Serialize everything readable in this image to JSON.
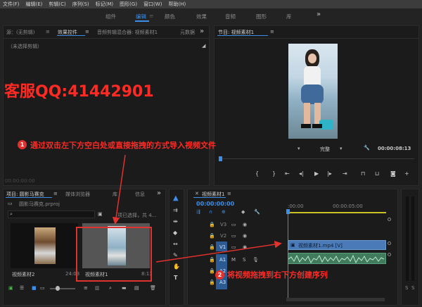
{
  "menu": [
    "文件(F)",
    "编辑(E)",
    "剪辑(C)",
    "序列(S)",
    "标记(M)",
    "图形(G)",
    "窗口(W)",
    "帮助(H)"
  ],
  "workspaces": {
    "assembly": "组件",
    "editing": "编辑",
    "color": "颜色",
    "effects": "效果",
    "audio": "音频",
    "graphics": "图形",
    "library": "库",
    "more": "»"
  },
  "source_panel": {
    "tab_source": "源：(无剪辑)",
    "tab_effect_controls": "效果控件",
    "tab_audio_mixer": "音频剪辑混合器: 视频素材1",
    "tab_metadata": "元数据",
    "no_clip": "（未选择剪辑）",
    "timecode": "00:00:00:00"
  },
  "program_panel": {
    "title": "节目: 视频素材1",
    "fit": "完整",
    "timecode": "00:00:08:13"
  },
  "project_panel": {
    "tab_project": "项目: 圆影马赛克",
    "tab_media_browser": "媒体浏览器",
    "tab_library": "库",
    "tab_info": "信息",
    "project_file": "圆影马赛克.prproj",
    "selection_info": "项已选择，共 4...",
    "items": [
      {
        "name": "视频素材2",
        "duration": "24:03"
      },
      {
        "name": "视频素材1",
        "duration": "8:13"
      }
    ]
  },
  "timeline": {
    "title": "视频素材1",
    "timecode": "00:00:00:00",
    "ruler": [
      ":00:00",
      "00:00:05:00"
    ],
    "tracks": [
      "V3",
      "V2",
      "V1",
      "A1",
      "A2",
      "A3"
    ],
    "clip_label": "视频素材1.mp4 [V]",
    "meter_labels": [
      "S",
      "S"
    ]
  },
  "overlay": {
    "watermark": "客服QQ:41442901",
    "step1_num": "1",
    "step1": "通过双击左下方空白处或直接拖拽的方式导入视频文件",
    "step2_num": "2",
    "step2": "将视频拖拽到右下方创建序列"
  },
  "colors": {
    "accent": "#3d8ee8",
    "annotation_red": "#e0322e",
    "clip_blue": "#4a7bb8",
    "audio_green": "#3f7b5c",
    "timecode_blue": "#3d8ee8"
  }
}
